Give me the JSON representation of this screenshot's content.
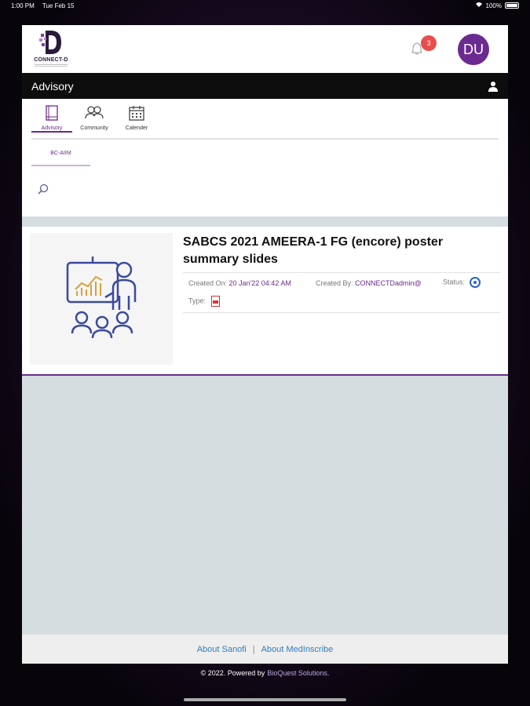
{
  "status_bar": {
    "time": "1:00 PM",
    "date": "Tue Feb 15",
    "battery": "100%"
  },
  "header": {
    "logo_text": "CONNECT-D",
    "notification_count": "3",
    "avatar_initials": "DU"
  },
  "page_bar": {
    "title": "Advisory"
  },
  "tabs": [
    {
      "label": "Advisory",
      "icon": "book-icon",
      "active": true
    },
    {
      "label": "Community",
      "icon": "users-icon",
      "active": false
    },
    {
      "label": "Calender",
      "icon": "calendar-icon",
      "active": false
    }
  ],
  "subtab": {
    "label": "BC-AIIM"
  },
  "card": {
    "title": "SABCS 2021 AMEERA-1 FG (encore) poster summary slides",
    "created_on_label": "Created On:",
    "created_on_value": "20 Jan'22 04:42 AM",
    "created_by_label": "Created By:",
    "created_by_value": "CONNECTDadmin@",
    "status_label": "Status:",
    "type_label": "Type:",
    "type_icon": "pdf-icon",
    "thumbnail_icon": "presentation-icon"
  },
  "footer": {
    "link_about_sanofi": "About Sanofi",
    "separator": "|",
    "link_about_medinscribe": "About MedInscribe",
    "copyright": "© 2022. Powered by",
    "brand": "BioQuest Solutions."
  },
  "colors": {
    "accent": "#6b2a8f",
    "badge": "#e84d4d",
    "link": "#2d7ec4",
    "panel_gray": "#d5dde0"
  }
}
